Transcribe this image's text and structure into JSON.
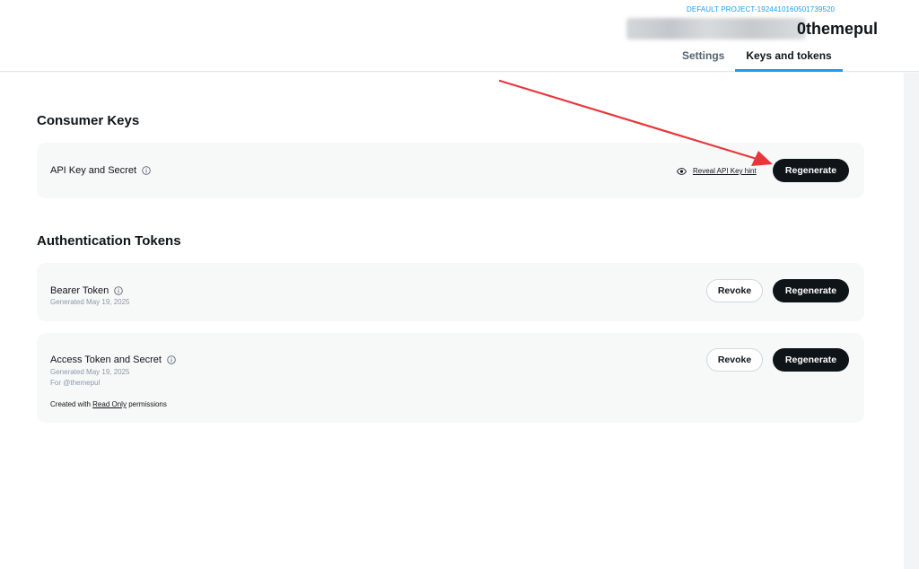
{
  "header": {
    "project_label": "DEFAULT PROJECT-1924410160501739520",
    "app_name_suffix": "0themepul",
    "tabs": [
      {
        "label": "Settings",
        "active": false
      },
      {
        "label": "Keys and tokens",
        "active": true
      }
    ]
  },
  "consumer_keys": {
    "section_title": "Consumer Keys",
    "api_key": {
      "title": "API Key and Secret",
      "reveal_label": "Reveal API Key hint",
      "regenerate_label": "Regenerate"
    }
  },
  "auth_tokens": {
    "section_title": "Authentication Tokens",
    "bearer": {
      "title": "Bearer Token",
      "generated": "Generated May 19, 2025",
      "revoke_label": "Revoke",
      "regenerate_label": "Regenerate"
    },
    "access": {
      "title": "Access Token and Secret",
      "generated": "Generated May 19, 2025",
      "for_user": "For @themepul",
      "created_prefix": "Created with",
      "permission": "Read Only",
      "created_suffix": "permissions",
      "revoke_label": "Revoke",
      "regenerate_label": "Regenerate"
    }
  },
  "colors": {
    "accent": "#1d9bf0",
    "annotation_arrow": "#e8373b",
    "dark_button": "#0f1419"
  }
}
